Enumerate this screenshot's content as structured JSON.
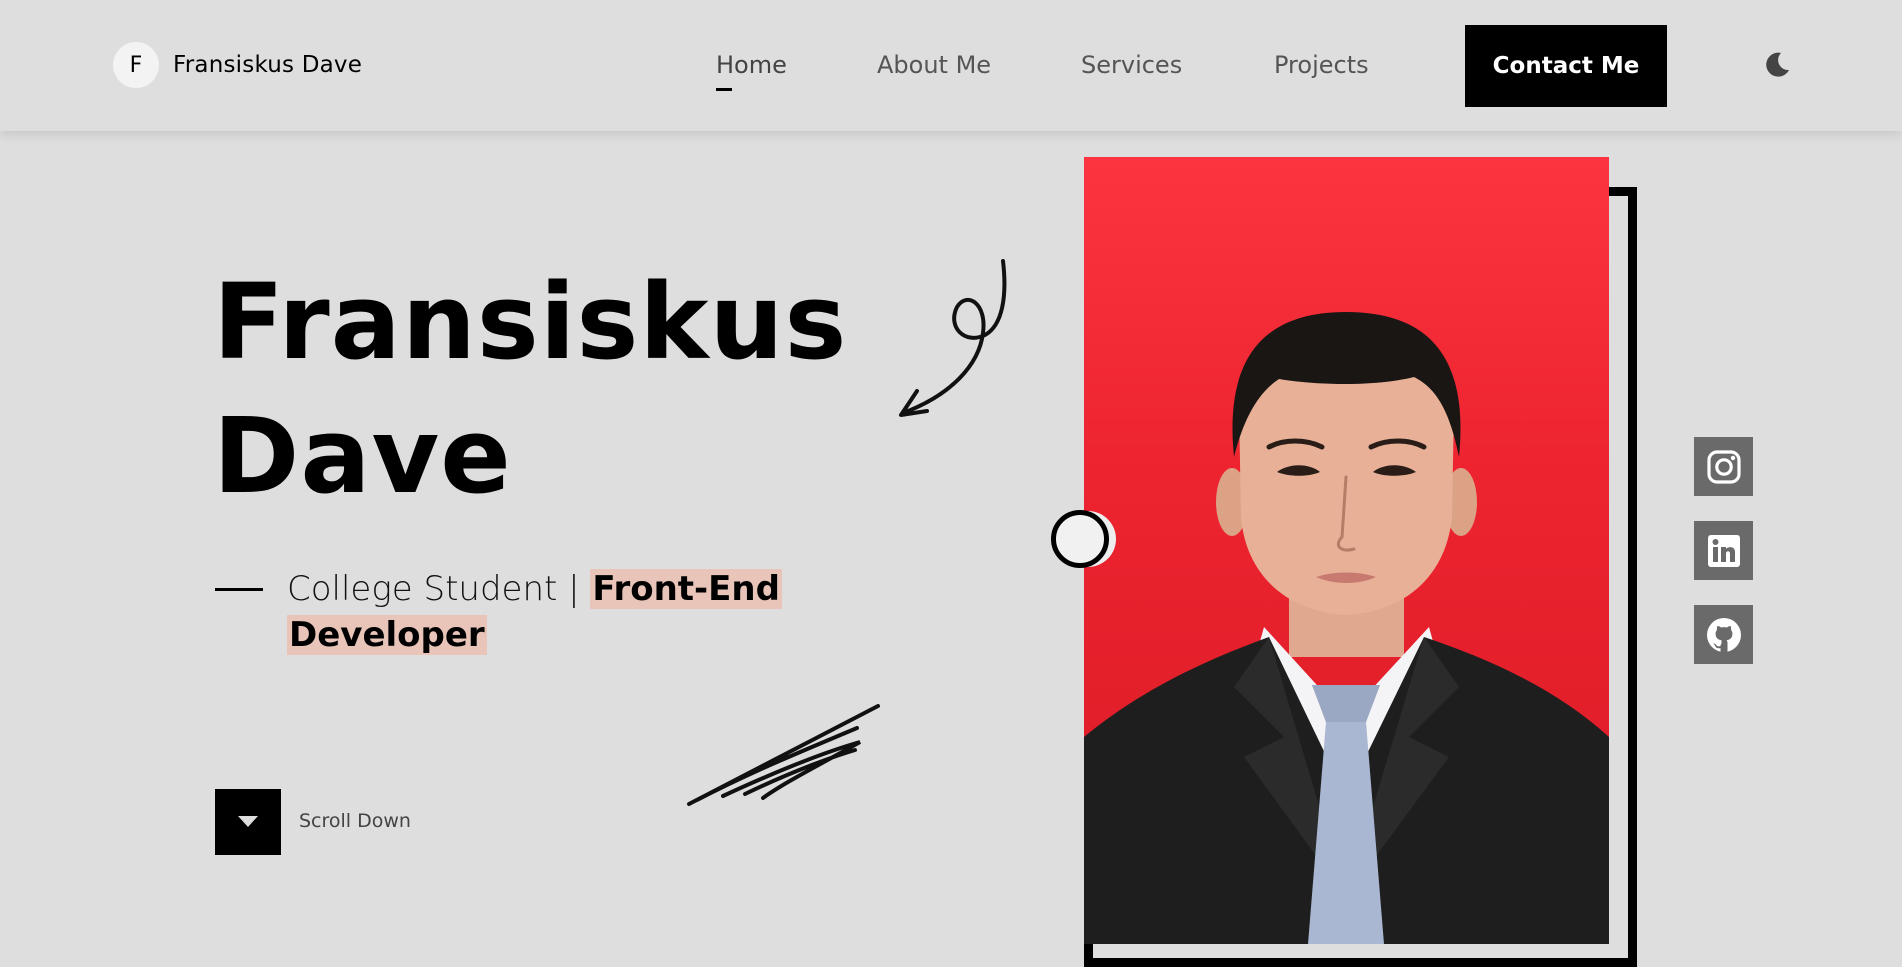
{
  "brand": {
    "initial": "F",
    "name": "Fransiskus Dave"
  },
  "nav": {
    "items": [
      {
        "label": "Home",
        "active": true
      },
      {
        "label": "About Me",
        "active": false
      },
      {
        "label": "Services",
        "active": false
      },
      {
        "label": "Projects",
        "active": false
      }
    ],
    "contact_label": "Contact Me",
    "theme_toggle_icon": "moon-icon"
  },
  "hero": {
    "title_line1": "Fransiskus",
    "title_line2": "Dave",
    "subtitle_plain": "College Student | ",
    "subtitle_highlight_1": "Front-End",
    "subtitle_highlight_2": "Developer",
    "highlight_color": "#e8c4b9",
    "scroll_label": "Scroll Down"
  },
  "portrait": {
    "background_color": "#ed2430"
  },
  "socials": [
    {
      "icon": "instagram-icon"
    },
    {
      "icon": "linkedin-icon"
    },
    {
      "icon": "github-icon"
    }
  ],
  "colors": {
    "page_background": "#dedede",
    "accent": "#000000"
  }
}
